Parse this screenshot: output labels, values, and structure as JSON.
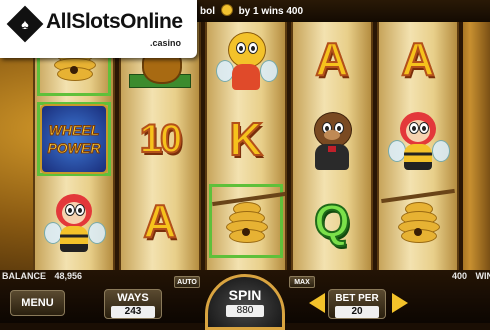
{
  "logo": {
    "name": "AllSlotsOnline",
    "suffix": ".casino",
    "icon": "spade-diamond-icon"
  },
  "win_message": {
    "prefix": "bol",
    "mid": "by 1 wins 400",
    "icon": "coin-icon"
  },
  "reels": [
    [
      "beehive",
      "wheel-power",
      "queen-bee"
    ],
    [
      "honey-pot-money",
      "10",
      "A"
    ],
    [
      "bee-waiter",
      "K",
      "beehive"
    ],
    [
      "A",
      "bear-butler",
      "Q"
    ],
    [
      "A",
      "queen-bee",
      "beehive"
    ]
  ],
  "symbols": {
    "wheel_power_line1": "WHEEL",
    "wheel_power_line2": "POWER"
  },
  "highlighted_cells": [
    [
      0,
      0
    ],
    [
      0,
      1
    ],
    [
      2,
      2
    ]
  ],
  "balance": {
    "label": "BALANCE",
    "value": "48,956"
  },
  "win": {
    "value": "400",
    "label": "WIN"
  },
  "buttons": {
    "menu": "MENU",
    "auto": "AUTO",
    "max": "MAX",
    "spin_label": "SPIN",
    "spin_value": "880"
  },
  "ways": {
    "label": "WAYS",
    "value": "243"
  },
  "bet_per": {
    "label": "BET PER",
    "value": "20"
  },
  "colors": {
    "accent": "#f3c22a",
    "highlight": "#5fc03a"
  }
}
